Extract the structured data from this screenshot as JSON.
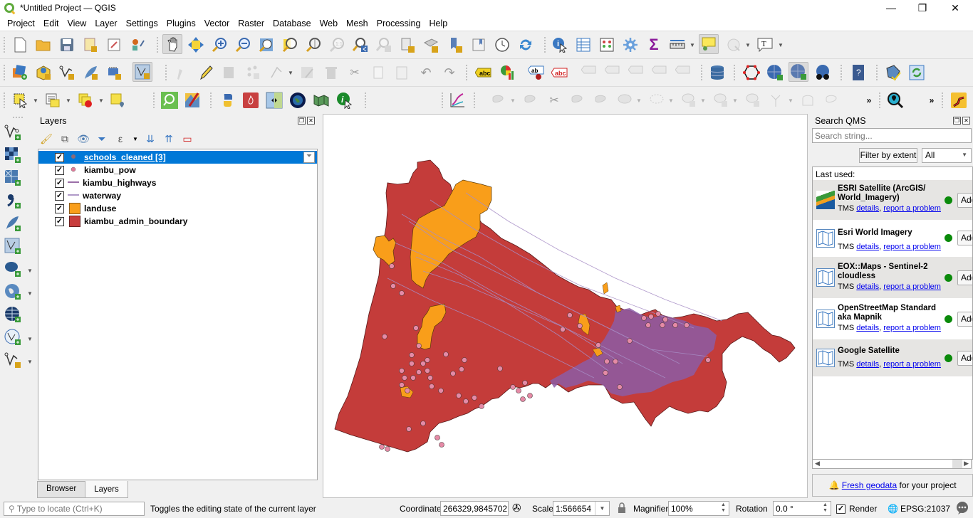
{
  "window": {
    "title": "*Untitled Project — QGIS",
    "minimize": "—",
    "restore": "❐",
    "close": "✕"
  },
  "menu": [
    "Project",
    "Edit",
    "View",
    "Layer",
    "Settings",
    "Plugins",
    "Vector",
    "Raster",
    "Database",
    "Web",
    "Mesh",
    "Processing",
    "Help"
  ],
  "layers_panel": {
    "title": "Layers",
    "layers": [
      {
        "name": "schools_cleaned [3]",
        "checked": true,
        "symbol": "point",
        "color": "#8a6a78",
        "selected": true,
        "filtered": true
      },
      {
        "name": "kiambu_pow",
        "checked": true,
        "symbol": "point",
        "color": "#e07a9a"
      },
      {
        "name": "kiambu_highways",
        "checked": true,
        "symbol": "line",
        "color": "#9b6fa8"
      },
      {
        "name": "waterway",
        "checked": true,
        "symbol": "line",
        "color": "#b09ac8"
      },
      {
        "name": "landuse",
        "checked": true,
        "symbol": "fill",
        "color": "#f99e1a"
      },
      {
        "name": "kiambu_admin_boundary",
        "checked": true,
        "symbol": "fill",
        "color": "#c83c3c"
      }
    ],
    "tabs": [
      "Browser",
      "Layers"
    ],
    "active_tab": "Layers"
  },
  "qms_panel": {
    "title": "Search QMS",
    "search_placeholder": "Search string...",
    "filter_button": "Filter by extent",
    "filter_select": "All",
    "last_used_label": "Last used:",
    "services": [
      {
        "name": "ESRI Satellite (ArcGIS/ World_Imagery)",
        "type": "TMS",
        "details": "details",
        "report": "report a problem",
        "status": "ok",
        "add": "Add"
      },
      {
        "name": "Esri World Imagery",
        "type": "TMS",
        "details": "details",
        "report": "report a problem",
        "status": "ok",
        "add": "Add"
      },
      {
        "name": "EOX::Maps - Sentinel-2 cloudless",
        "type": "TMS",
        "details": "details",
        "report": "report a problem",
        "status": "ok",
        "add": "Add"
      },
      {
        "name": "OpenStreetMap Standard aka Mapnik",
        "type": "TMS",
        "details": "details",
        "report": "report a problem",
        "status": "ok",
        "add": "Add"
      },
      {
        "name": "Google Satellite",
        "type": "TMS",
        "details": "details",
        "report": "report a problem",
        "status": "ok",
        "add": "Add"
      }
    ],
    "fresh_link": "Fresh geodata",
    "fresh_text": " for your project"
  },
  "status": {
    "locator_placeholder": "Type to locate (Ctrl+K)",
    "message": "Toggles the editing state of the current layer",
    "coordinate_label": "Coordinate",
    "coordinate": "266329,9845702",
    "scale_label": "Scale",
    "scale": "1:566654",
    "magnifier_label": "Magnifier",
    "magnifier": "100%",
    "rotation_label": "Rotation",
    "rotation": "0.0 °",
    "render_label": "Render",
    "render_checked": true,
    "crs": "EPSG:21037"
  },
  "map": {
    "colors": {
      "boundary": "#c43c3a",
      "landuse": "#f99e1a",
      "highways": "#8c5ca6",
      "waterway": "#a78ec6",
      "pow": "#e58aa6"
    }
  }
}
